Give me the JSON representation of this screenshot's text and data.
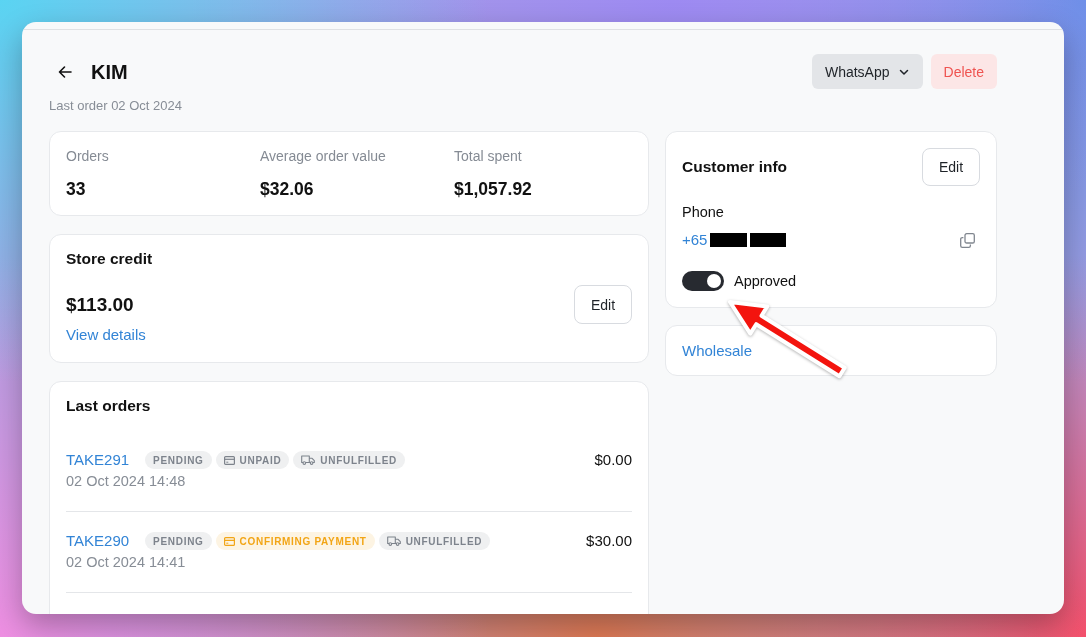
{
  "page": {
    "title": "KIM",
    "subtitle": "Last order 02 Oct 2024",
    "actions": [
      {
        "label": "WhatsApp",
        "kind": "dropdown"
      },
      {
        "label": "Delete",
        "kind": "danger"
      }
    ]
  },
  "stats": [
    {
      "label": "Orders",
      "value": "33"
    },
    {
      "label": "Average order value",
      "value": "$32.06"
    },
    {
      "label": "Total spent",
      "value": "$1,057.92"
    }
  ],
  "store_credit": {
    "title": "Store credit",
    "amount": "$113.00",
    "link": "View details",
    "button": "Edit"
  },
  "last_orders": {
    "title": "Last orders",
    "rows": [
      {
        "id": "TAKE291",
        "badges": [
          {
            "label": "PENDING",
            "kind": "status",
            "color": "#7d838c"
          },
          {
            "label": "UNPAID",
            "kind": "payment",
            "color": "#7d838c"
          },
          {
            "label": "UNFULFILLED",
            "kind": "fulfillment",
            "color": "#7d838c"
          }
        ],
        "date": "02 Oct 2024 14:48",
        "total": "$0.00"
      },
      {
        "id": "TAKE290",
        "badges": [
          {
            "label": "PENDING",
            "kind": "status",
            "color": "#7d838c"
          },
          {
            "label": "CONFIRMING PAYMENT",
            "kind": "payment",
            "color": "#f2a516"
          },
          {
            "label": "UNFULFILLED",
            "kind": "fulfillment",
            "color": "#7d838c"
          }
        ],
        "date": "02 Oct 2024 14:41",
        "total": "$30.00"
      }
    ]
  },
  "customer_info": {
    "title": "Customer info",
    "button": "Edit",
    "phone_label": "Phone",
    "phone": "+65",
    "approved": {
      "label": "Approved",
      "on": true
    }
  },
  "tags_card": {
    "link": "Wholesale"
  }
}
